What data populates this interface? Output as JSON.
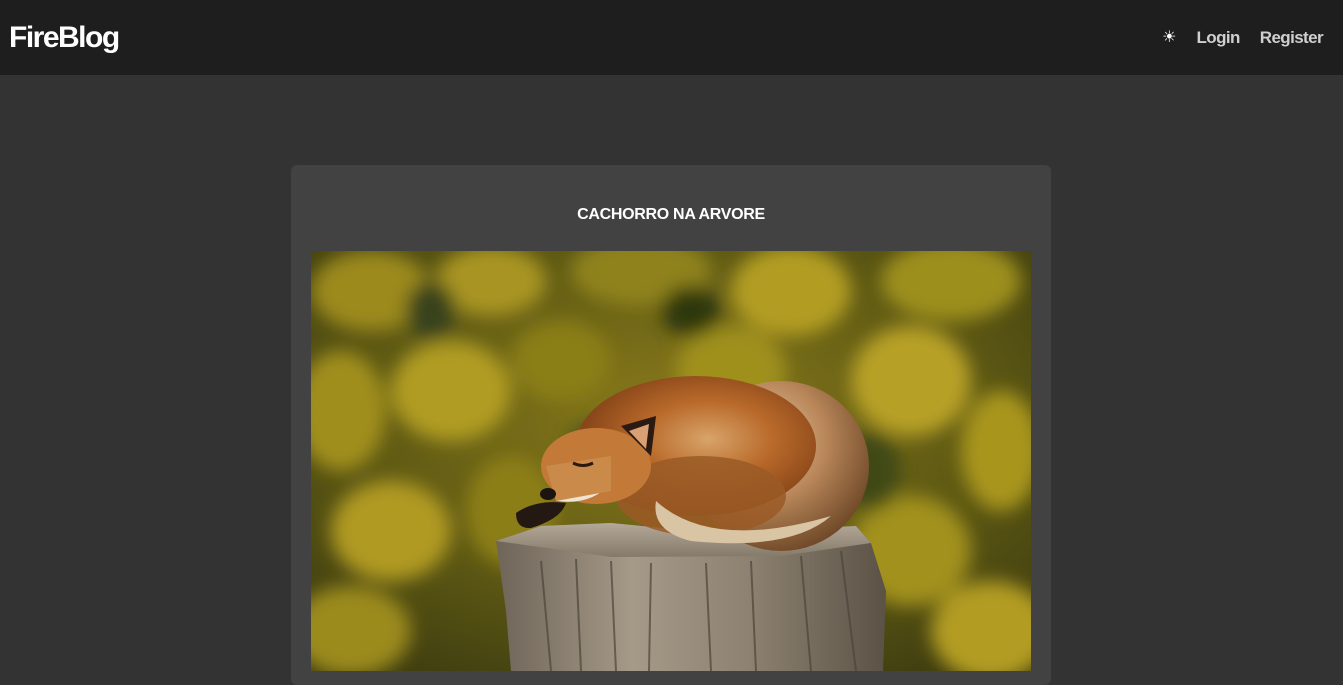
{
  "navbar": {
    "brand": "FireBlog",
    "theme_icon": "sun-icon",
    "theme_glyph": "☀",
    "links": [
      {
        "label": "Login"
      },
      {
        "label": "Register"
      }
    ]
  },
  "post": {
    "title": "CACHORRO NA ARVORE",
    "image_alt": "fox sleeping on a tree stump"
  },
  "colors": {
    "page_bg": "#333333",
    "navbar_bg": "#1e1e1e",
    "card_bg": "#424242",
    "link": "#cfcfcf"
  }
}
